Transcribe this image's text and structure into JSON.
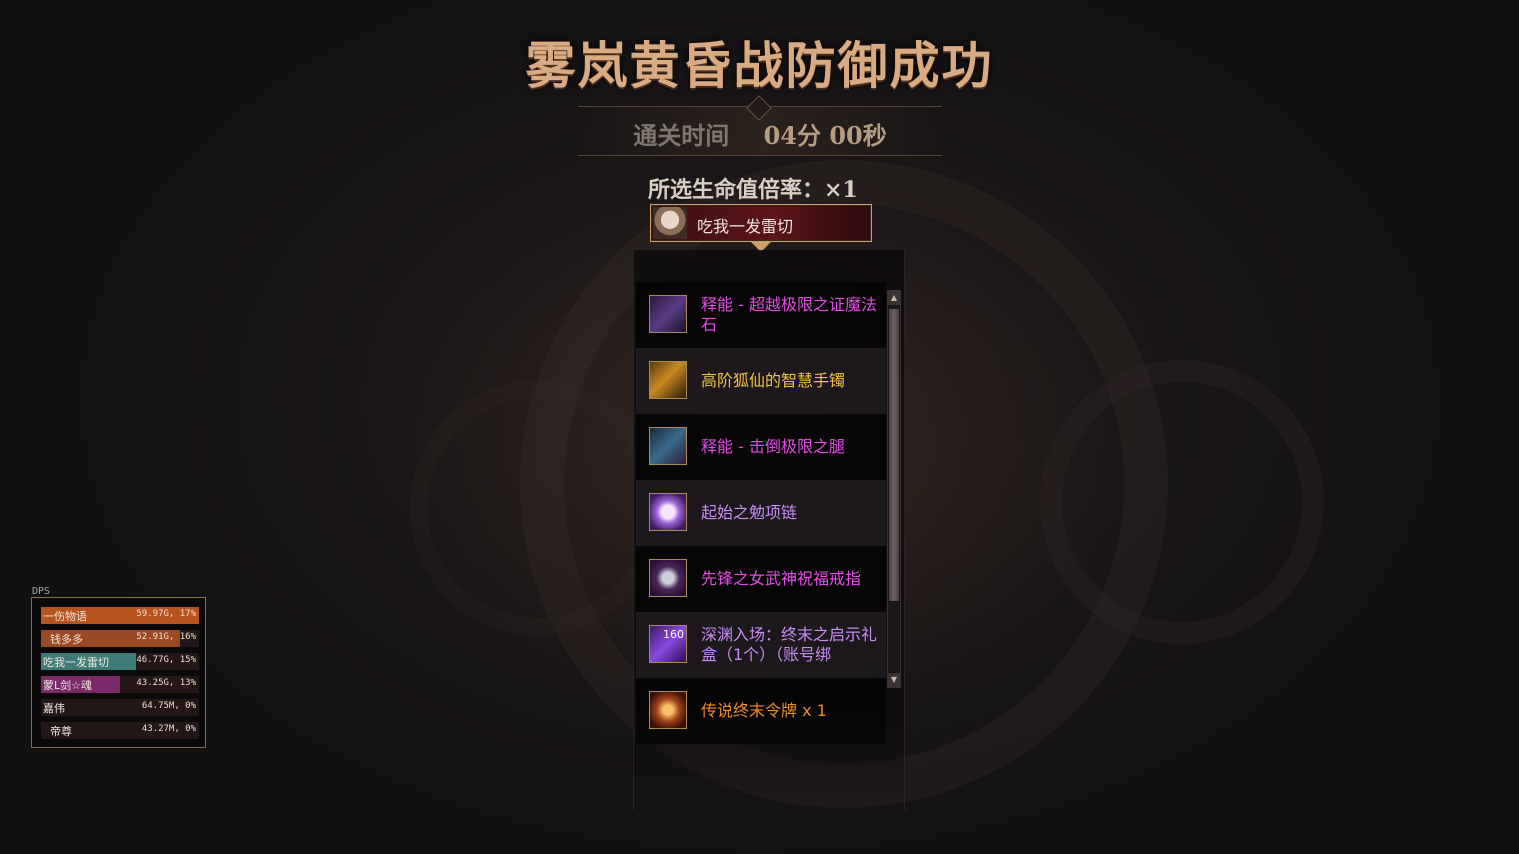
{
  "title": "雾岚黄昏战防御成功",
  "clear_time": {
    "label": "通关时间",
    "value": "04分 00秒"
  },
  "hp_rate": "所选生命值倍率：×1",
  "player": {
    "name": "吃我一发雷切"
  },
  "rewards": [
    {
      "name": "释能 - 超越极限之证魔法石",
      "color": "#e44ce6",
      "icon": "magic-stone-icon"
    },
    {
      "name": "高阶狐仙的智慧手镯",
      "color": "#f2c046",
      "icon": "bracelet-icon"
    },
    {
      "name": "释能 - 击倒极限之腿",
      "color": "#e44ce6",
      "icon": "leg-armor-icon"
    },
    {
      "name": "起始之勉项链",
      "color": "#c88cf2",
      "icon": "necklace-icon"
    },
    {
      "name": "先锋之女武神祝福戒指",
      "color": "#e44ce6",
      "icon": "ring-icon"
    },
    {
      "name": "深渊入场：终末之启示礼盒（1个）（账号绑",
      "color": "#c88cf2",
      "icon": "gift-box-icon",
      "badge": "160"
    },
    {
      "name": "传说终末令牌 x 1",
      "color": "#f08a2a",
      "icon": "token-icon"
    }
  ],
  "dps": {
    "title": "DPS",
    "rows": [
      {
        "name": "一伤物语",
        "value": "59.97G, 17%",
        "fill": 1.0,
        "color": "#b8521e"
      },
      {
        "name": "  钱多多",
        "value": "52.91G, 16%",
        "fill": 0.88,
        "color": "#9a4a22"
      },
      {
        "name": "吃我一发雷切",
        "value": "46.77G, 15%",
        "fill": 0.6,
        "color": "#3e7a78"
      },
      {
        "name": "蒙L剑☆魂",
        "value": "43.25G, 13%",
        "fill": 0.5,
        "color": "#7a2a6a"
      },
      {
        "name": "嘉伟",
        "value": "64.75M, 0%",
        "fill": 0.0,
        "color": "#5a1a1a"
      },
      {
        "name": "  帝尊",
        "value": "43.27M, 0%",
        "fill": 0.0,
        "color": "#5a1a1a"
      }
    ]
  }
}
